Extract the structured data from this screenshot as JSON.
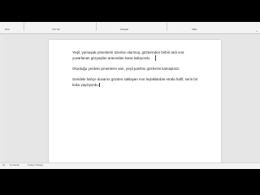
{
  "ribbon": {
    "groups": [
      "Pano",
      "Yazı Tipi",
      "Paragraf",
      "Stiller"
    ]
  },
  "document": {
    "paragraphs": [
      "Yeşil, yumuşak çimenlerin üzerine oturmuş, gözlerinden birbiri ardı sıra yuvarlanan gözyaşları arasından bana bakıyordu.",
      "Oturduğu yerdeki çimenlerin sarı, yeşil parıltısı gözlerimi kamaştırdı.",
      "Gerideki bahçe duvarını gözden saklayan mor leylaklardan etrafa hafif, serin bir koku yayılıyordu."
    ]
  },
  "statusbar": {
    "page": "1/1",
    "words": "51 sözcük",
    "language": "Türkçe (Türkiye)"
  }
}
